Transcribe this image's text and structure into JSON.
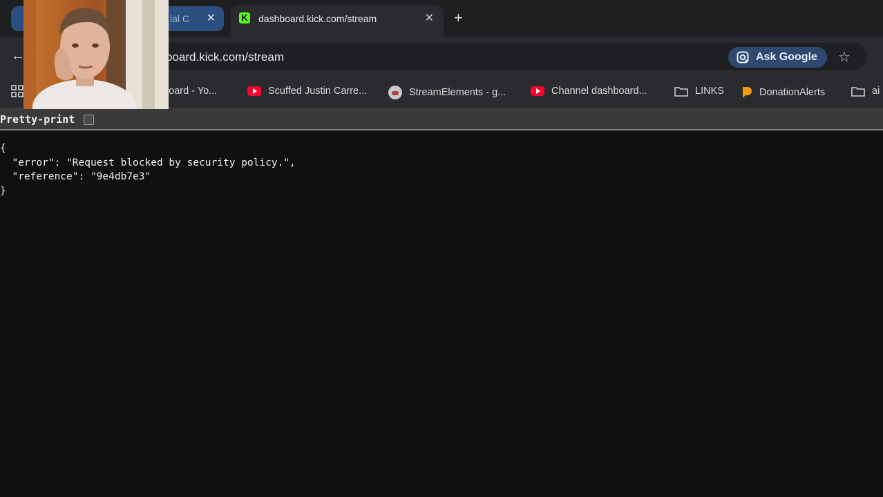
{
  "browser": {
    "tabs": [
      {
        "title": "ial C",
        "close": "✕",
        "active": false
      },
      {
        "title": "dashboard.kick.com/stream",
        "close": "✕",
        "active": true,
        "favicon": "K"
      }
    ],
    "new_tab": "+",
    "address": {
      "url": "board.kick.com/stream"
    },
    "ask_google": "Ask Google",
    "bookmarks": [
      {
        "label": "hboard - Yo...",
        "icon": "youtube-icon"
      },
      {
        "label": "Scuffed Justin Carre...",
        "icon": "youtube-icon"
      },
      {
        "label": "StreamElements - g...",
        "icon": "streamelements-icon"
      },
      {
        "label": "Channel dashboard...",
        "icon": "youtube-icon"
      },
      {
        "label": "LINKS",
        "icon": "folder-icon"
      },
      {
        "label": "DonationAlerts",
        "icon": "donationalerts-icon"
      },
      {
        "label": "ai",
        "icon": "folder-icon"
      }
    ]
  },
  "viewer": {
    "pretty_print_label": "Pretty-print",
    "pretty_print_checked": false
  },
  "json_lines": [
    "{",
    "  \"error\": \"Request blocked by security policy.\",",
    "  \"reference\": \"9e4db7e3\"",
    "}"
  ],
  "colors": {
    "kick_green": "#53fc18",
    "youtube_red": "#ff0033",
    "ask_google_bg": "#2e4870"
  }
}
